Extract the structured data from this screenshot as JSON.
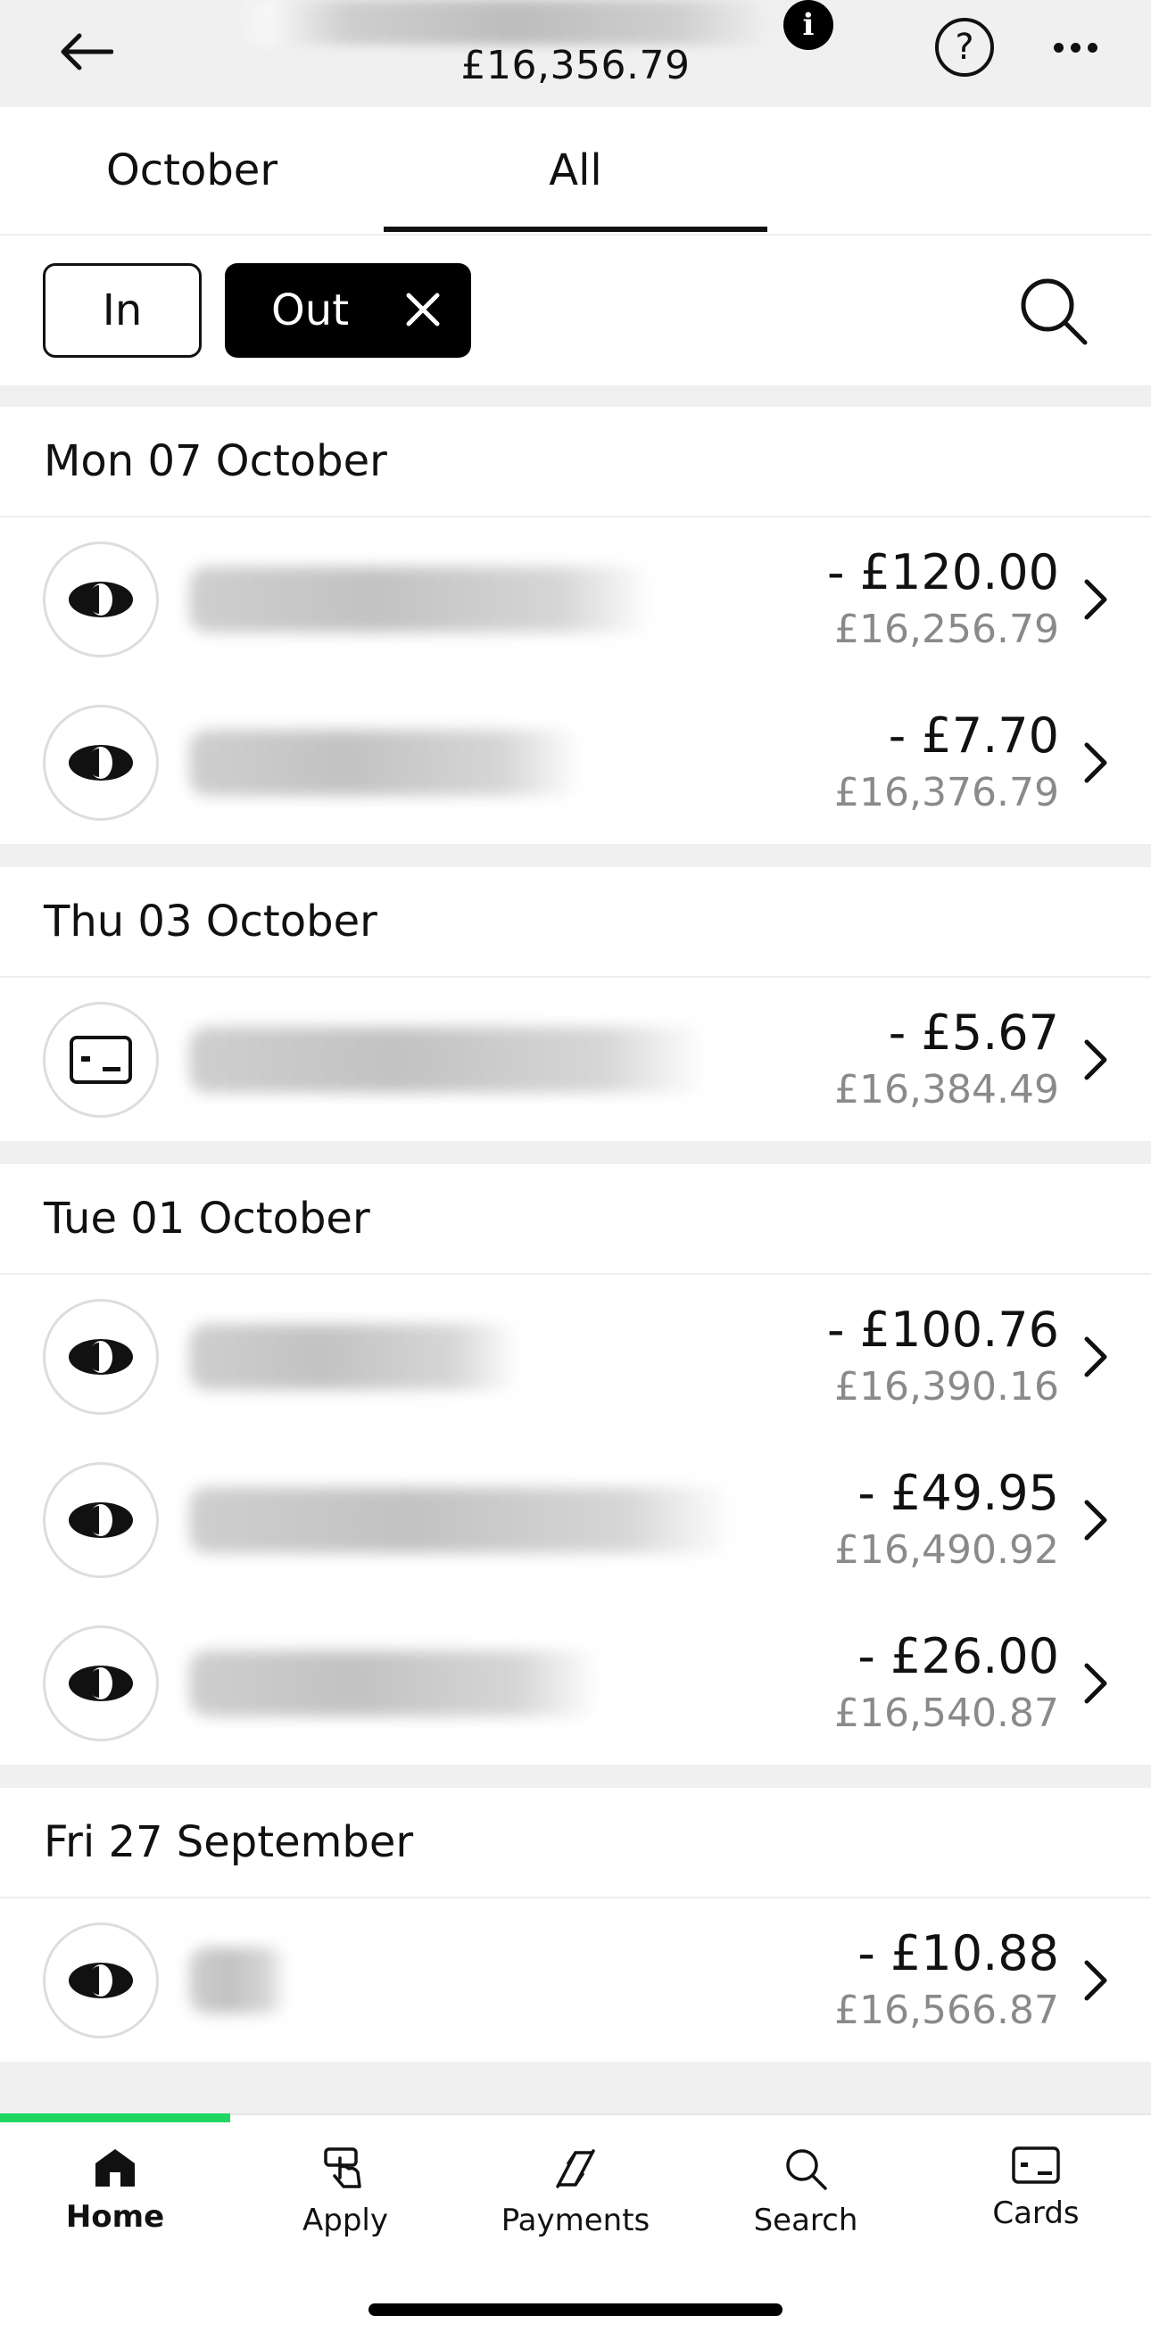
{
  "header": {
    "balance": "£16,356.79",
    "back_icon": "arrow-left-icon",
    "info_icon": "info-icon",
    "help_icon": "question-icon",
    "more_icon": "ellipsis-icon"
  },
  "tabs": [
    {
      "label": "October",
      "active": false
    },
    {
      "label": "All",
      "active": true
    }
  ],
  "filters": {
    "in_label": "In",
    "out_label": "Out",
    "out_selected": true
  },
  "sections": [
    {
      "date": "Mon 07 October",
      "transactions": [
        {
          "icon": "eye-icon",
          "amount": "- £120.00",
          "running": "£16,256.79"
        },
        {
          "icon": "eye-icon",
          "amount": "- £7.70",
          "running": "£16,376.79"
        }
      ]
    },
    {
      "date": "Thu 03 October",
      "transactions": [
        {
          "icon": "card-icon",
          "amount": "- £5.67",
          "running": "£16,384.49"
        }
      ]
    },
    {
      "date": "Tue 01 October",
      "transactions": [
        {
          "icon": "eye-icon",
          "amount": "- £100.76",
          "running": "£16,390.16"
        },
        {
          "icon": "eye-icon",
          "amount": "- £49.95",
          "running": "£16,490.92"
        },
        {
          "icon": "eye-icon",
          "amount": "- £26.00",
          "running": "£16,540.87"
        }
      ]
    },
    {
      "date": "Fri 27 September",
      "transactions": [
        {
          "icon": "eye-icon",
          "amount": "- £10.88",
          "running": "£16,566.87"
        }
      ]
    }
  ],
  "nav": [
    {
      "label": "Home",
      "icon": "home-icon",
      "active": true
    },
    {
      "label": "Apply",
      "icon": "tap-hand-icon",
      "active": false
    },
    {
      "label": "Payments",
      "icon": "payments-arrows-icon",
      "active": false
    },
    {
      "label": "Search",
      "icon": "search-icon",
      "active": false
    },
    {
      "label": "Cards",
      "icon": "card-icon",
      "active": false
    }
  ],
  "colors": {
    "accent": "#1ed760",
    "text": "#111111",
    "muted": "#8a8a8a",
    "background": "#f0f0f0"
  }
}
